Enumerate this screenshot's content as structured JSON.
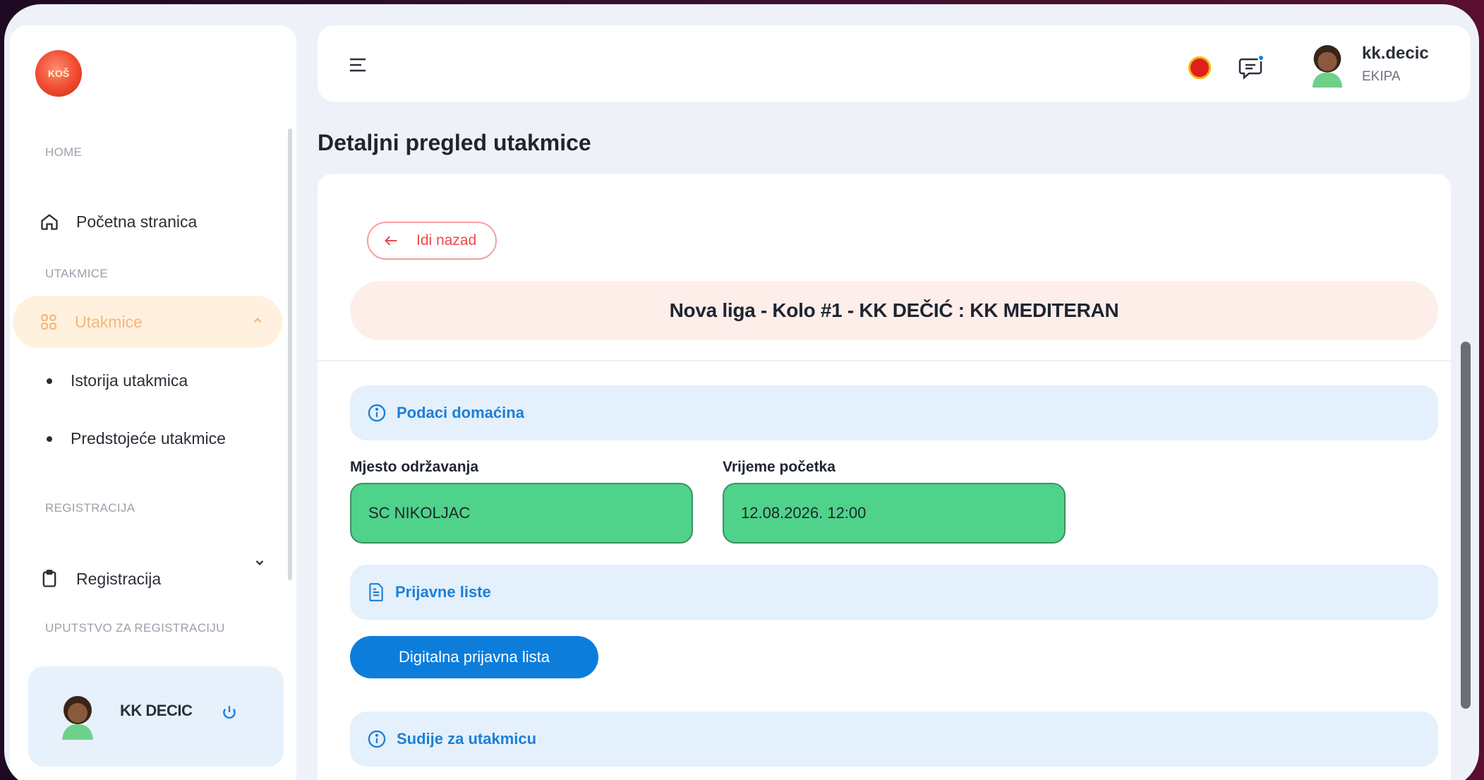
{
  "logo": {
    "text": "KOŠ"
  },
  "sidebar": {
    "home_label": "HOME",
    "home_item": "Početna stranica",
    "matches_label": "UTAKMICE",
    "matches_item": "Utakmice",
    "sub_items": [
      "Istorija utakmica",
      "Predstojeće utakmice"
    ],
    "registration_label": "REGISTRACIJA",
    "registration_item": "Registracija",
    "guide_label": "UPUTSTVO ZA REGISTRACIJU",
    "user_name": "KK DECIC"
  },
  "header": {
    "username": "kk.decic",
    "role": "EKIPA"
  },
  "page": {
    "title": "Detaljni pregled utakmice",
    "back_label": "Idi nazad",
    "match_title": "Nova liga - Kolo #1 - KK DEČIĆ : KK MEDITERAN",
    "host_section": "Podaci domaćina",
    "venue_label": "Mjesto održavanja",
    "venue_value": "SC NIKOLJAC",
    "start_label": "Vrijeme početka",
    "start_value": "12.08.2026. 12:00",
    "lists_section": "Prijavne liste",
    "digital_list_button": "Digitalna prijavna lista",
    "referees_section": "Sudije za utakmicu"
  },
  "colors": {
    "accent_blue": "#0d7ddb",
    "active_nav": "#f4b77a",
    "field_green": "#4fd28a",
    "back_red": "#e94b4b"
  },
  "icons": [
    "home-icon",
    "grid-icon",
    "clipboard-icon",
    "power-icon",
    "hamburger-icon",
    "chat-icon",
    "info-icon",
    "document-icon",
    "arrow-left-icon",
    "chevron-up-icon",
    "chevron-down-icon"
  ]
}
